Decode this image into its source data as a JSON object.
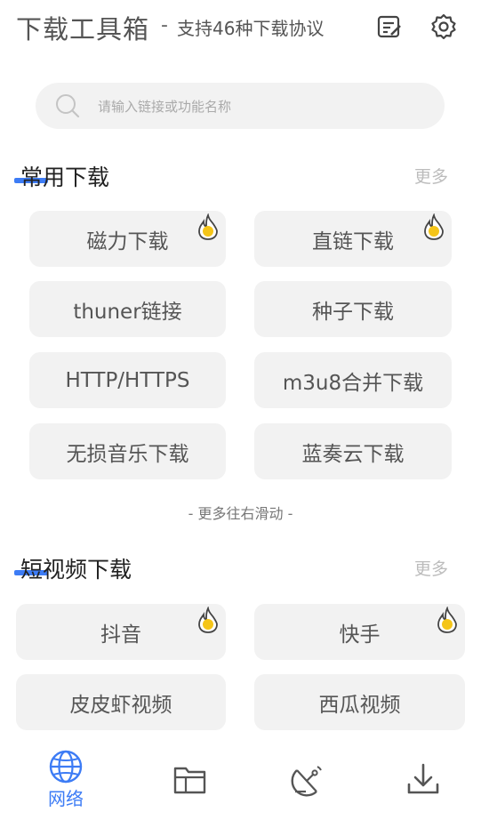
{
  "header": {
    "title": "下载工具箱",
    "separator": "-",
    "subtitle": "支持46种下载协议",
    "icons": [
      "notes-edit-icon",
      "settings-icon"
    ]
  },
  "search": {
    "placeholder": "请输入链接或功能名称"
  },
  "sections": [
    {
      "title": "常用下载",
      "more": "更多",
      "items": [
        {
          "label": "磁力下载",
          "hot": true
        },
        {
          "label": "直链下载",
          "hot": true
        },
        {
          "label": "thuner链接",
          "hot": false
        },
        {
          "label": "种子下载",
          "hot": false
        },
        {
          "label": "HTTP/HTTPS",
          "hot": false
        },
        {
          "label": "m3u8合并下载",
          "hot": false
        },
        {
          "label": "无损音乐下载",
          "hot": false
        },
        {
          "label": "蓝奏云下载",
          "hot": false
        }
      ],
      "hint": "- 更多往右滑动 -"
    },
    {
      "title": "短视频下载",
      "more": "更多",
      "items": [
        {
          "label": "抖音",
          "hot": true
        },
        {
          "label": "快手",
          "hot": true
        },
        {
          "label": "皮皮虾视频",
          "hot": false
        },
        {
          "label": "西瓜视频",
          "hot": false
        }
      ]
    }
  ],
  "bottom_nav": {
    "active": "网络",
    "items": [
      {
        "icon": "globe-icon",
        "label": "网络"
      },
      {
        "icon": "folder-icon",
        "label": ""
      },
      {
        "icon": "satellite-dish-icon",
        "label": ""
      },
      {
        "icon": "download-icon",
        "label": ""
      }
    ]
  },
  "colors": {
    "accent": "#3d7cf5",
    "hot_badge": "#f5c518",
    "button_bg": "#f2f2f2"
  }
}
